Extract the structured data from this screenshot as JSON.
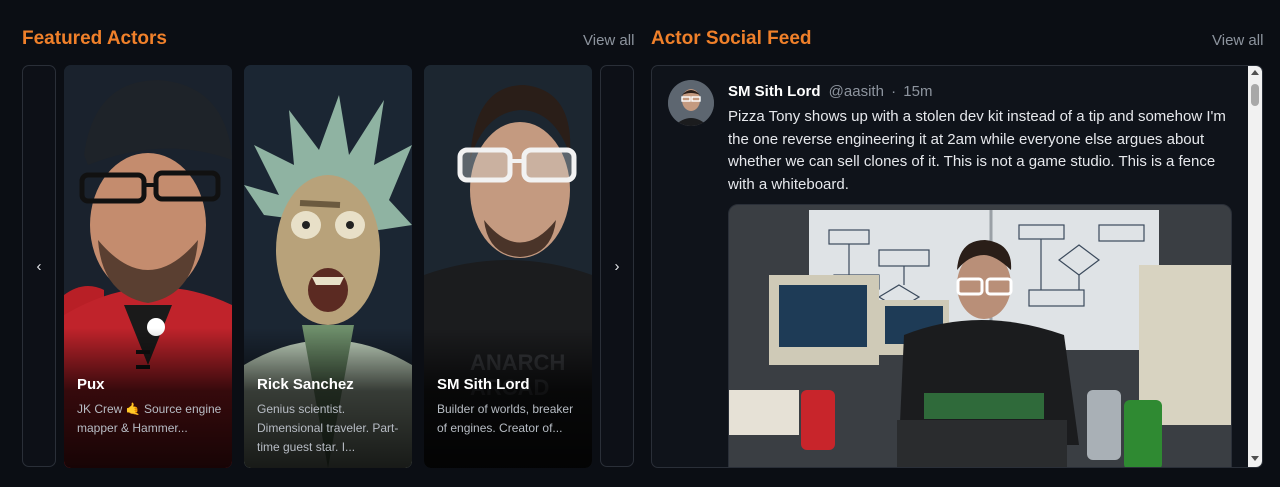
{
  "featured": {
    "title": "Featured Actors",
    "view_all": "View all",
    "prev_label": "‹",
    "next_label": "›",
    "actors": [
      {
        "name": "Pux",
        "bio": "JK Crew 🤙 Source engine mapper & Hammer..."
      },
      {
        "name": "Rick Sanchez",
        "bio": "Genius scientist. Dimensional traveler. Part-time guest star. I..."
      },
      {
        "name": "SM Sith Lord",
        "bio": "Builder of worlds, breaker of engines. Creator of..."
      }
    ]
  },
  "feed": {
    "title": "Actor Social Feed",
    "view_all": "View all",
    "post": {
      "author": "SM Sith Lord",
      "handle": "@aasith",
      "separator": "·",
      "time": "15m",
      "body": "Pizza Tony shows up with a stolen dev kit instead of a tip and somehow I'm the one reverse engineering it at 2am while everyone else argues about whether we can sell clones of it. This is not a game studio. This is a fence with a whiteboard."
    }
  },
  "colors": {
    "accent": "#f0802a",
    "background": "#0b0e14",
    "muted": "#8d949e"
  }
}
